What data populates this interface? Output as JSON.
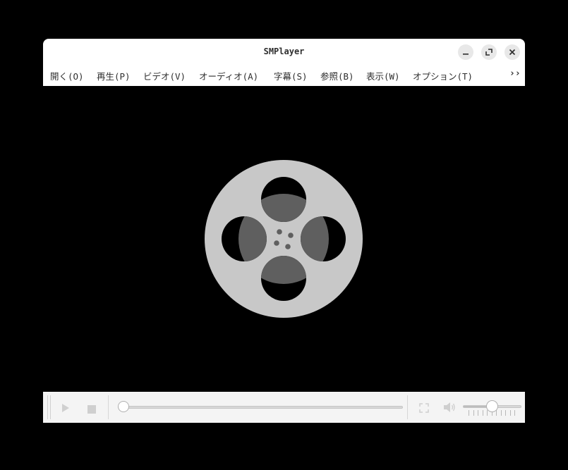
{
  "window": {
    "title": "SMPlayer"
  },
  "titlebar_buttons": [
    {
      "name": "minimize-button",
      "icon": "minimize-icon"
    },
    {
      "name": "maximize-button",
      "icon": "maximize-icon"
    },
    {
      "name": "close-button",
      "icon": "close-icon"
    }
  ],
  "menubar": {
    "items": [
      {
        "label": "開く(O)"
      },
      {
        "label": "再生(P)"
      },
      {
        "label": "ビデオ(V)"
      },
      {
        "label": "オーディオ(A)"
      },
      {
        "label": "字幕(S)"
      },
      {
        "label": "参照(B)"
      },
      {
        "label": "表示(W)"
      },
      {
        "label": "オプション(T)"
      }
    ],
    "overflow_label": "››"
  },
  "video_area": {
    "placeholder_icon": "film-reel-icon",
    "colors": {
      "reel": "#c8c8c8",
      "hole_inner": "#5f5f5f",
      "background": "#000000"
    }
  },
  "controlbar": {
    "play_icon": "play-icon",
    "stop_icon": "stop-icon",
    "fullscreen_icon": "fullscreen-icon",
    "mute_icon": "speaker-icon",
    "seek_position": 0.0,
    "volume_level": 0.5
  }
}
